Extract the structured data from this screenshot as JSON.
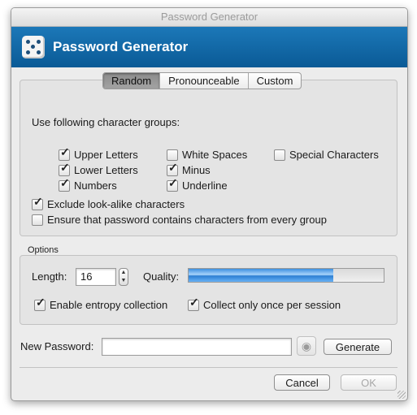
{
  "window": {
    "title": "Password Generator"
  },
  "banner": {
    "title": "Password Generator"
  },
  "tabs": [
    {
      "label": "Random",
      "active": true
    },
    {
      "label": "Pronounceable",
      "active": false
    },
    {
      "label": "Custom",
      "active": false
    }
  ],
  "groups": {
    "heading": "Use following character groups:",
    "upper": {
      "label": "Upper Letters",
      "checked": true
    },
    "lower": {
      "label": "Lower Letters",
      "checked": true
    },
    "numbers": {
      "label": "Numbers",
      "checked": true
    },
    "white": {
      "label": "White Spaces",
      "checked": false
    },
    "minus": {
      "label": "Minus",
      "checked": true
    },
    "underline": {
      "label": "Underline",
      "checked": true
    },
    "special": {
      "label": "Special Characters",
      "checked": false
    },
    "exclude": {
      "label": "Exclude look-alike characters",
      "checked": true
    },
    "ensure": {
      "label": "Ensure that password contains characters from every group",
      "checked": false
    }
  },
  "options": {
    "heading": "Options",
    "length_label": "Length:",
    "length_value": "16",
    "quality_label": "Quality:",
    "quality_fraction": 0.74,
    "entropy": {
      "label": "Enable entropy collection",
      "checked": true
    },
    "once": {
      "label": "Collect only once per session",
      "checked": true
    }
  },
  "password": {
    "label": "New Password:",
    "value": "",
    "generate_label": "Generate"
  },
  "footer": {
    "cancel_label": "Cancel",
    "ok_label": "OK"
  },
  "icons": {
    "dice": "dice-icon",
    "eye": "eye-icon",
    "grip": "resize-grip-icon"
  },
  "colors": {
    "banner": "#0a5a96",
    "quality": "#3c8fe0"
  }
}
